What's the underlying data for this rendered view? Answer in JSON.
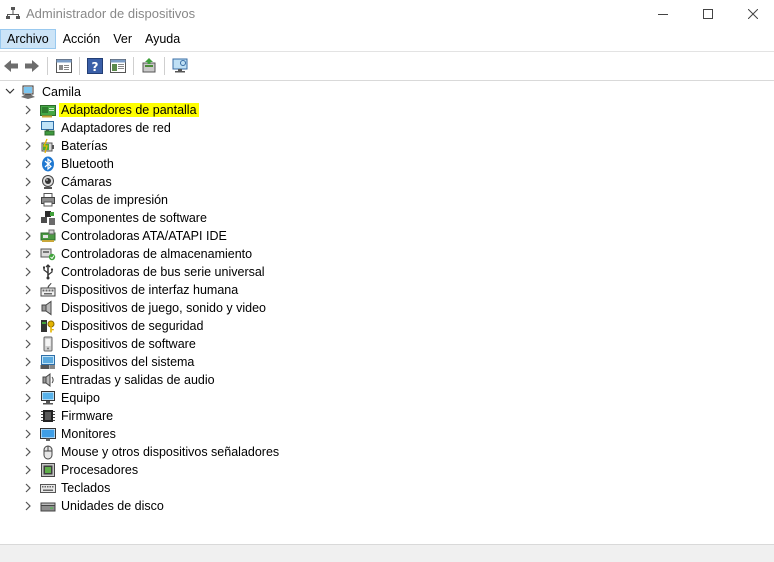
{
  "window": {
    "title": "Administrador de dispositivos"
  },
  "menu": {
    "items": [
      "Archivo",
      "Acción",
      "Ver",
      "Ayuda"
    ],
    "active_index": 0
  },
  "toolbar": {
    "icons": [
      "back-arrow-icon",
      "forward-arrow-icon",
      "properties-icon",
      "help-icon",
      "view-icon",
      "update-driver-icon",
      "scan-hardware-icon"
    ]
  },
  "tree": {
    "root": "Camila",
    "categories": [
      {
        "label": "Adaptadores de pantalla",
        "icon": "display-adapter-icon",
        "highlighted": true
      },
      {
        "label": "Adaptadores de red",
        "icon": "network-adapter-icon"
      },
      {
        "label": "Baterías",
        "icon": "battery-icon"
      },
      {
        "label": "Bluetooth",
        "icon": "bluetooth-icon"
      },
      {
        "label": "Cámaras",
        "icon": "camera-icon"
      },
      {
        "label": "Colas de impresión",
        "icon": "printer-icon"
      },
      {
        "label": "Componentes de software",
        "icon": "software-component-icon"
      },
      {
        "label": "Controladoras ATA/ATAPI IDE",
        "icon": "ide-controller-icon"
      },
      {
        "label": "Controladoras de almacenamiento",
        "icon": "storage-controller-icon"
      },
      {
        "label": "Controladoras de bus serie universal",
        "icon": "usb-icon"
      },
      {
        "label": "Dispositivos de interfaz humana",
        "icon": "hid-icon"
      },
      {
        "label": "Dispositivos de juego, sonido y video",
        "icon": "speaker-icon"
      },
      {
        "label": "Dispositivos de seguridad",
        "icon": "security-device-icon"
      },
      {
        "label": "Dispositivos de software",
        "icon": "software-device-icon"
      },
      {
        "label": "Dispositivos del sistema",
        "icon": "system-device-icon"
      },
      {
        "label": "Entradas y salidas de audio",
        "icon": "audio-io-icon"
      },
      {
        "label": "Equipo",
        "icon": "computer-icon"
      },
      {
        "label": "Firmware",
        "icon": "firmware-icon"
      },
      {
        "label": "Monitores",
        "icon": "monitor-icon"
      },
      {
        "label": "Mouse y otros dispositivos señaladores",
        "icon": "mouse-icon"
      },
      {
        "label": "Procesadores",
        "icon": "processor-icon"
      },
      {
        "label": "Teclados",
        "icon": "keyboard-icon"
      },
      {
        "label": "Unidades de disco",
        "icon": "disk-drive-icon"
      }
    ]
  },
  "colors": {
    "highlight": "#ffff00",
    "menu_active_bg": "#cce4f7"
  }
}
